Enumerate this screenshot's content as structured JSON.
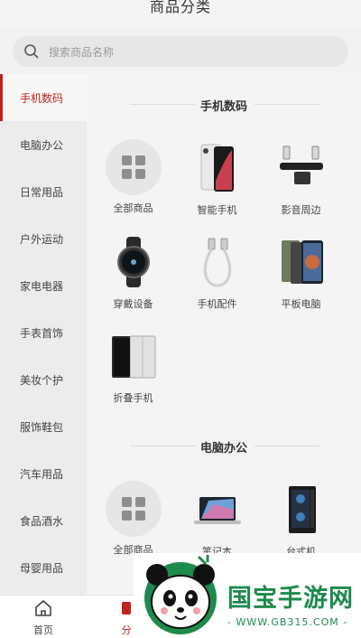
{
  "header": {
    "title": "商品分类"
  },
  "search": {
    "placeholder": "搜索商品名称"
  },
  "sidebar": {
    "items": [
      {
        "label": "手机数码",
        "active": true
      },
      {
        "label": "电脑办公"
      },
      {
        "label": "日常用品"
      },
      {
        "label": "户外运动"
      },
      {
        "label": "家电电器"
      },
      {
        "label": "手表首饰"
      },
      {
        "label": "美妆个护"
      },
      {
        "label": "服饰鞋包"
      },
      {
        "label": "汽车用品"
      },
      {
        "label": "食品酒水"
      },
      {
        "label": "母婴用品"
      }
    ]
  },
  "sections": [
    {
      "title": "手机数码",
      "items": [
        {
          "label": "全部商品",
          "icon": "grid-icon"
        },
        {
          "label": "智能手机",
          "icon": "smartphone-image"
        },
        {
          "label": "影音周边",
          "icon": "soundbar-image"
        },
        {
          "label": "穿戴设备",
          "icon": "smartwatch-image"
        },
        {
          "label": "手机配件",
          "icon": "cable-image"
        },
        {
          "label": "平板电脑",
          "icon": "tablet-image"
        },
        {
          "label": "折叠手机",
          "icon": "foldable-phone-image"
        }
      ]
    },
    {
      "title": "电脑办公",
      "items": [
        {
          "label": "全部商品",
          "icon": "grid-icon"
        },
        {
          "label": "笔记本",
          "icon": "laptop-image"
        },
        {
          "label": "台式机",
          "icon": "desktop-tower-image"
        }
      ]
    }
  ],
  "tabbar": {
    "home": {
      "label": "首页",
      "icon": "home-icon"
    },
    "category": {
      "label": "分",
      "icon": "category-icon"
    }
  },
  "watermark": {
    "brand": "国宝手游网",
    "url": "- WWW.GB315.COM -"
  },
  "colors": {
    "accent": "#c0221d",
    "watermark_green": "#1e8a4c"
  }
}
